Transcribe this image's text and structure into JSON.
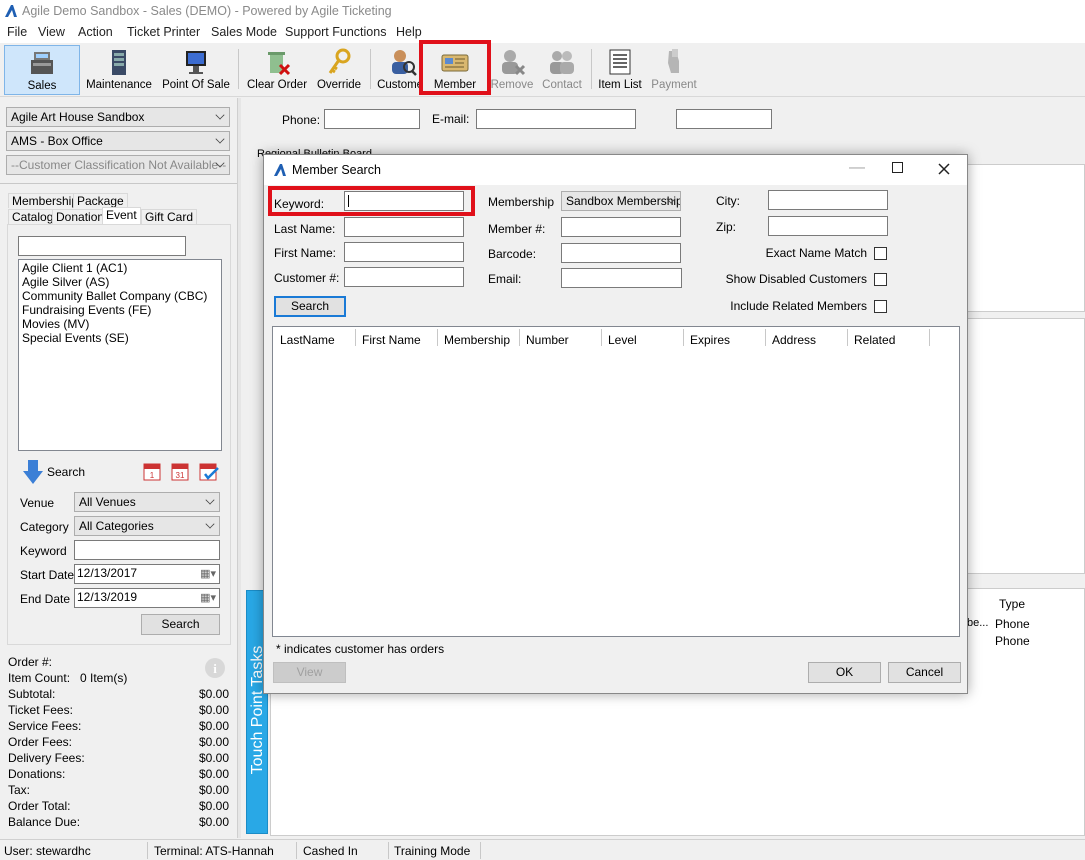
{
  "window": {
    "title": "Agile Demo Sandbox - Sales (DEMO) - Powered by Agile Ticketing"
  },
  "menu": [
    "File",
    "View",
    "Action",
    "Ticket Printer",
    "Sales Mode",
    "Support Functions",
    "Help"
  ],
  "toolbar": {
    "sales": "Sales",
    "maintenance": "Maintenance",
    "point_of_sale": "Point Of Sale",
    "clear_order": "Clear Order",
    "override": "Override",
    "customer": "Customer",
    "member": "Member",
    "remove": "Remove",
    "contact": "Contact",
    "item_list": "Item List",
    "payment": "Payment"
  },
  "left": {
    "venue_select": "Agile Art House Sandbox",
    "office_select": "AMS - Box Office",
    "classification_select": "--Customer Classification Not Available--",
    "tabs": {
      "membership": "Membership",
      "package": "Package",
      "catalog": "Catalog",
      "donation": "Donation",
      "event": "Event",
      "gift_card": "Gift Card"
    },
    "search_box": "",
    "list": [
      "Agile Client 1  (AC1)",
      "Agile Silver  (AS)",
      "Community Ballet Company  (CBC)",
      "Fundraising Events  (FE)",
      "Movies  (MV)",
      "Special Events  (SE)"
    ],
    "search_label": "Search",
    "venue_label": "Venue",
    "venue_value": "All Venues",
    "category_label": "Category",
    "category_value": "All Categories",
    "keyword_label": "Keyword",
    "keyword_value": "",
    "start_label": "Start Date",
    "start_value": "12/13/2017",
    "end_label": "End Date",
    "end_value": "12/13/2019",
    "search_button": "Search"
  },
  "summary": {
    "order_no": "Order #:",
    "item_count_label": "Item Count:",
    "item_count_value": "0 Item(s)",
    "rows": [
      {
        "label": "Subtotal:",
        "value": "$0.00"
      },
      {
        "label": "Ticket Fees:",
        "value": "$0.00"
      },
      {
        "label": "Service Fees:",
        "value": "$0.00"
      },
      {
        "label": "Order Fees:",
        "value": "$0.00"
      },
      {
        "label": "Delivery Fees:",
        "value": "$0.00"
      },
      {
        "label": "Donations:",
        "value": "$0.00"
      },
      {
        "label": "Tax:",
        "value": "$0.00"
      },
      {
        "label": "Order Total:",
        "value": "$0.00"
      },
      {
        "label": "Balance Due:",
        "value": "$0.00"
      }
    ]
  },
  "main": {
    "phone_label": "Phone:",
    "email_label": "E-mail:",
    "bulletin": "Regional Bulletin Board",
    "side_tab": "Touch Point Tasks",
    "type_header": "Type",
    "type_rows": [
      "Phone",
      "Phone"
    ],
    "trunc_text": "be..."
  },
  "modal": {
    "title": "Member Search",
    "keyword_label": "Keyword:",
    "keyword_value": "",
    "last_name_label": "Last Name:",
    "first_name_label": "First Name:",
    "customer_no_label": "Customer #:",
    "membership_label": "Membership",
    "membership_value": "Sandbox Membership",
    "member_no_label": "Member #:",
    "barcode_label": "Barcode:",
    "email_label": "Email:",
    "city_label": "City:",
    "zip_label": "Zip:",
    "exact_match": "Exact Name Match",
    "show_disabled": "Show Disabled Customers",
    "include_related": "Include Related Members",
    "search_button": "Search",
    "columns": [
      "LastName",
      "First Name",
      "Membership",
      "Number",
      "Level",
      "Expires",
      "Address",
      "Related"
    ],
    "footnote": "* indicates customer has orders",
    "view_button": "View",
    "ok_button": "OK",
    "cancel_button": "Cancel"
  },
  "status": {
    "user": "User:  stewardhc",
    "terminal": "Terminal: ATS-Hannah",
    "cashed": "Cashed In",
    "mode": "Training Mode"
  },
  "colors": {
    "accent": "#1a7ad6",
    "highlight": "#e0101a",
    "touch_tab": "#29a8e6"
  }
}
